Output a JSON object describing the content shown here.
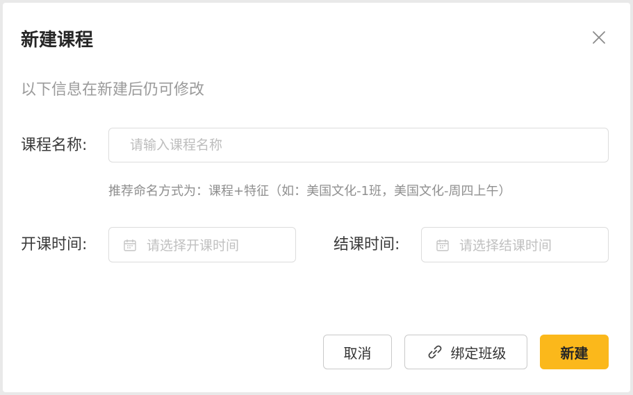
{
  "dialog": {
    "title": "新建课程",
    "close_icon": "close-icon",
    "hint": "以下信息在新建后仍可修改"
  },
  "form": {
    "course_name": {
      "label": "课程名称:",
      "placeholder": "请输入课程名称",
      "value": "",
      "tip": "推荐命名方式为：课程+特征（如：美国文化-1班，美国文化-周四上午）"
    },
    "start_time": {
      "label": "开课时间:",
      "placeholder": "请选择开课时间",
      "icon": "calendar-icon"
    },
    "end_time": {
      "label": "结课时间:",
      "placeholder": "请选择结课时间",
      "icon": "calendar-icon"
    }
  },
  "footer": {
    "cancel_label": "取消",
    "bind_label": "绑定班级",
    "bind_icon": "link-icon",
    "create_label": "新建"
  },
  "colors": {
    "primary": "#fbb81b",
    "border": "#dcdcdc",
    "muted_text": "#9a9a9a"
  }
}
